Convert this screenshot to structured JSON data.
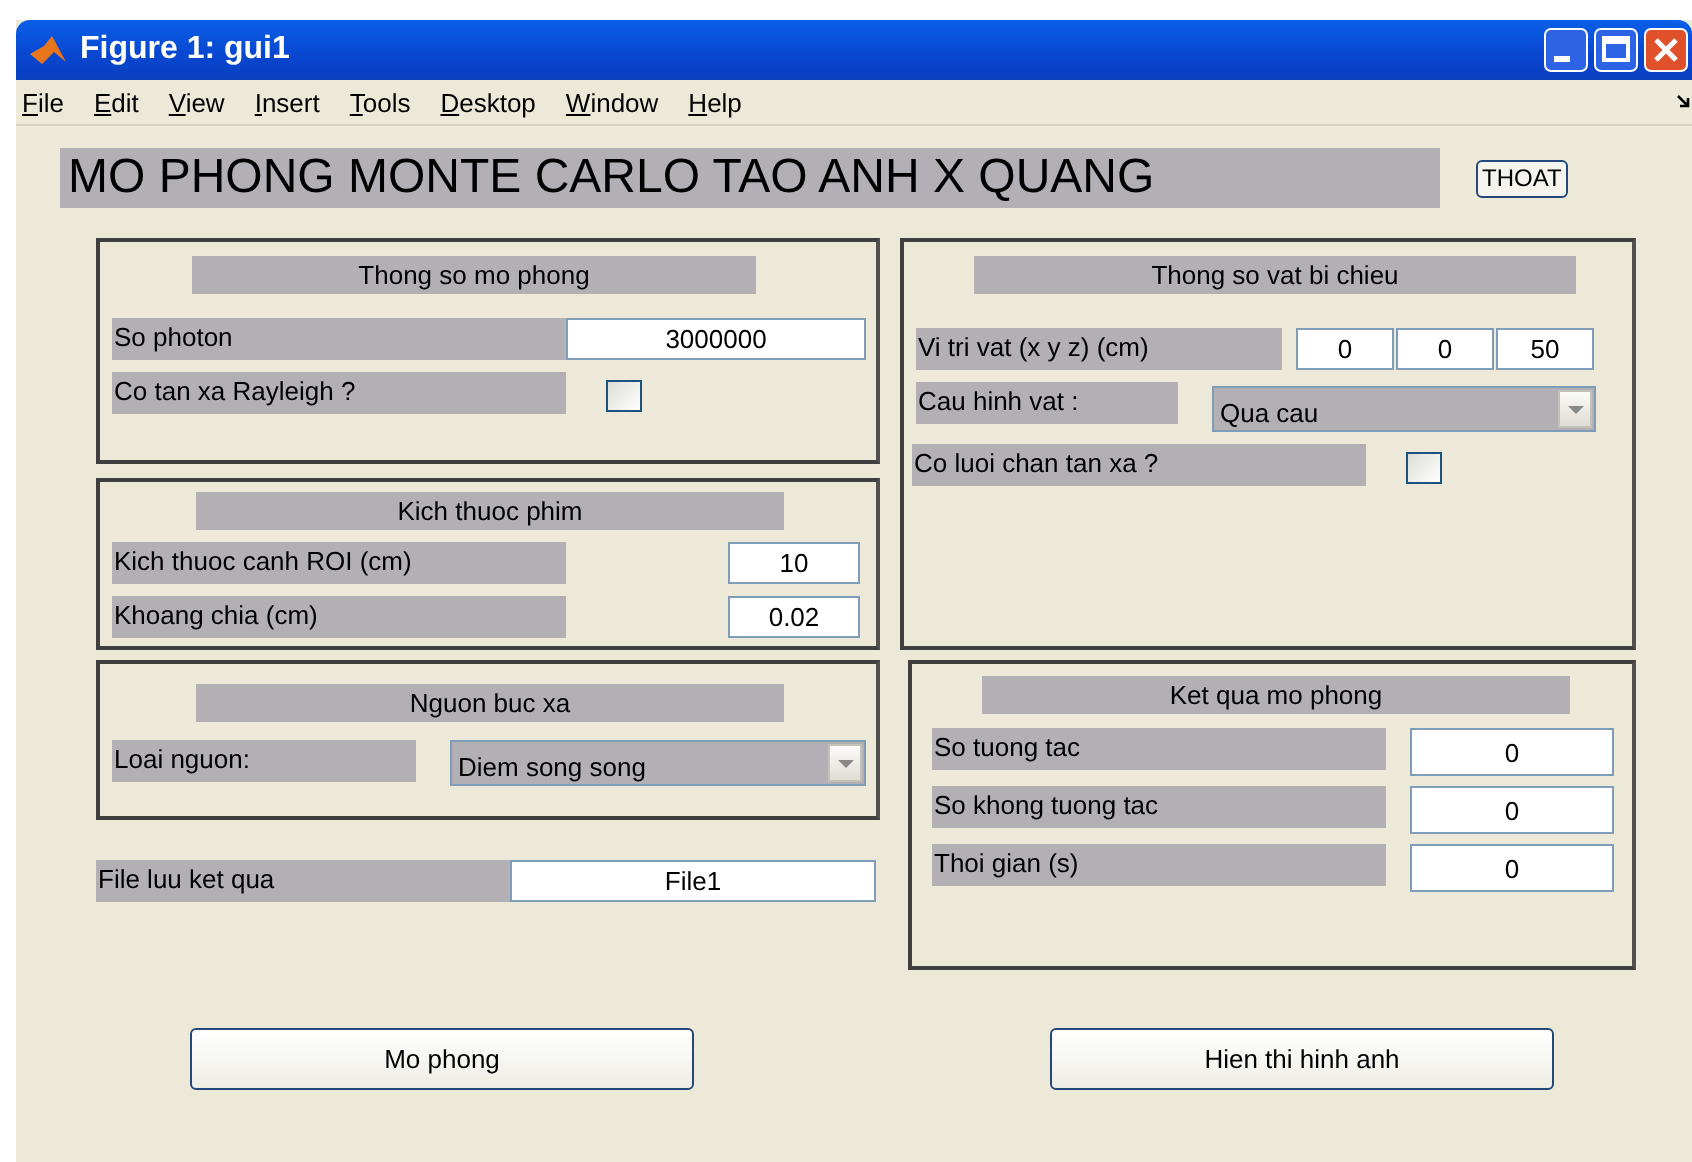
{
  "window": {
    "title": "Figure 1: gui1"
  },
  "menu": [
    "File",
    "Edit",
    "View",
    "Insert",
    "Tools",
    "Desktop",
    "Window",
    "Help"
  ],
  "heading": "MO PHONG MONTE CARLO TAO ANH X QUANG",
  "exit_button": "THOAT",
  "left_panels": [
    {
      "title": "Thong so mo phong",
      "rows": [
        {
          "kind": "field",
          "label": "So photon",
          "value": "3000000"
        },
        {
          "kind": "checkbox",
          "label": "Co tan xa Rayleigh ?",
          "checked": false
        }
      ]
    },
    {
      "title": "Kich thuoc phim",
      "rows": [
        {
          "kind": "field",
          "label": "Kich thuoc canh ROI (cm)",
          "value": "10"
        },
        {
          "kind": "field",
          "label": "Khoang chia (cm)",
          "value": "0.02"
        }
      ]
    },
    {
      "title": "Nguon buc xa",
      "rows": [
        {
          "kind": "dropdown",
          "label": "Loai nguon:",
          "value": "Diem song song"
        }
      ]
    }
  ],
  "file": {
    "label": "File luu ket qua",
    "value": "File1"
  },
  "right_panels": [
    {
      "title": "Thong so vat bi chieu",
      "rows": [
        {
          "kind": "fields",
          "label": "Vi tri vat (x y z) (cm)",
          "values": [
            "0",
            "0",
            "50"
          ]
        },
        {
          "kind": "dropdown",
          "label": "Cau hinh vat :",
          "value": "Qua cau"
        },
        {
          "kind": "checkbox",
          "label": "Co luoi chan tan xa ?",
          "checked": false
        }
      ]
    },
    {
      "title": "Ket qua mo phong",
      "rows": [
        {
          "kind": "field",
          "label": "So tuong tac",
          "value": "0"
        },
        {
          "kind": "field",
          "label": "So khong tuong tac",
          "value": "0"
        },
        {
          "kind": "field",
          "label": "Thoi gian (s)",
          "value": "0"
        }
      ]
    }
  ],
  "buttons": [
    "Mo phong",
    "Hien thi hinh anh"
  ]
}
